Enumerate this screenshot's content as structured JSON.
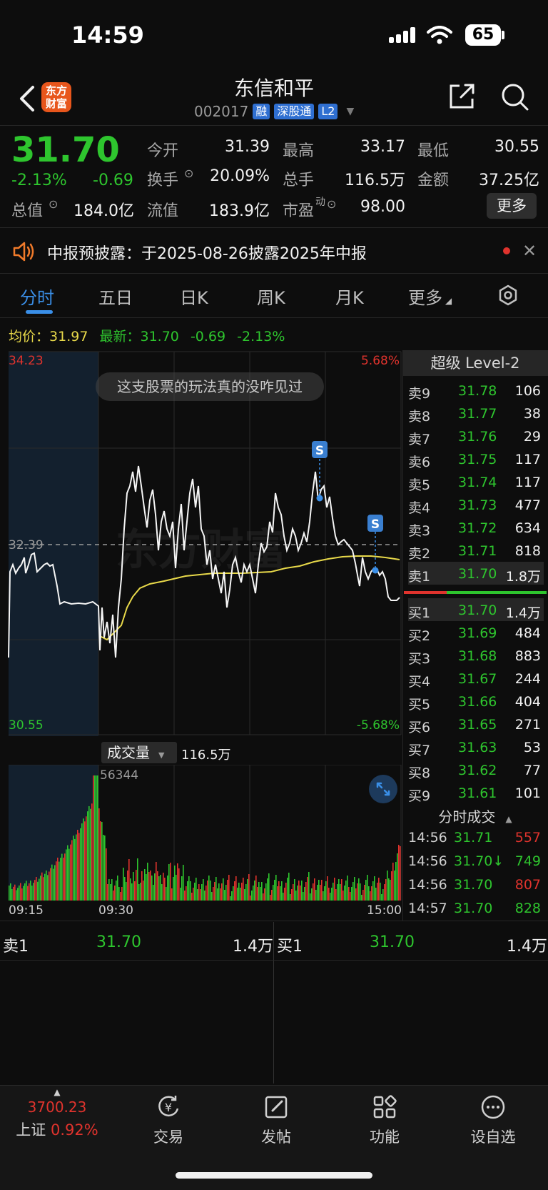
{
  "status_bar": {
    "time": "14:59",
    "battery": "65"
  },
  "header": {
    "logo_line1": "东方",
    "logo_line2": "财富",
    "stock_name": "东信和平",
    "stock_code": "002017",
    "tags": [
      "融",
      "深股通",
      "L2"
    ]
  },
  "quote": {
    "price": "31.70",
    "change_pct": "-2.13%",
    "change": "-0.69",
    "fields": {
      "open_label": "今开",
      "open_value": "31.39",
      "high_label": "最高",
      "high_value": "33.17",
      "low_label": "最低",
      "low_value": "30.55",
      "turnover_label": "换手",
      "turnover_value": "20.09%",
      "volume_label": "总手",
      "volume_value": "116.5万",
      "amount_label": "金额",
      "amount_value": "37.25亿",
      "mktcap_label": "总值",
      "mktcap_value": "184.0亿",
      "float_label": "流值",
      "float_value": "183.9亿",
      "pe_label": "市盈",
      "pe_sup": "动",
      "pe_value": "98.00"
    },
    "more_label": "更多"
  },
  "notice": {
    "text": "中报预披露：于2025-08-26披露2025年中报"
  },
  "tabs": [
    "分时",
    "五日",
    "日K",
    "周K",
    "月K",
    "更多"
  ],
  "intraday": {
    "avg_label": "均价：",
    "avg_value": "31.97",
    "latest_label": "最新：",
    "latest_value": "31.70",
    "latest_change": "-0.69",
    "latest_pct": "-2.13%",
    "y_top": "34.23",
    "y_bottom": "30.55",
    "y_mid": "32.39",
    "pct_top": "5.68%",
    "pct_bottom": "-5.68%",
    "bubble": "这支股票的玩法真的没咋见过",
    "marker": "S",
    "watermark": "东方财富",
    "volume_label": "成交量",
    "volume_total": "116.5万",
    "volume_max": "56344",
    "time_start": "09:15",
    "time_open": "09:30",
    "time_end": "15:00"
  },
  "level2": {
    "title": "超级 Level-2",
    "asks": [
      {
        "label": "卖9",
        "price": "31.78",
        "vol": "106"
      },
      {
        "label": "卖8",
        "price": "31.77",
        "vol": "38"
      },
      {
        "label": "卖7",
        "price": "31.76",
        "vol": "29"
      },
      {
        "label": "卖6",
        "price": "31.75",
        "vol": "117"
      },
      {
        "label": "卖5",
        "price": "31.74",
        "vol": "117"
      },
      {
        "label": "卖4",
        "price": "31.73",
        "vol": "477"
      },
      {
        "label": "卖3",
        "price": "31.72",
        "vol": "634"
      },
      {
        "label": "卖2",
        "price": "31.71",
        "vol": "818"
      },
      {
        "label": "卖1",
        "price": "31.70",
        "vol": "1.8万"
      }
    ],
    "bids": [
      {
        "label": "买1",
        "price": "31.70",
        "vol": "1.4万"
      },
      {
        "label": "买2",
        "price": "31.69",
        "vol": "484"
      },
      {
        "label": "买3",
        "price": "31.68",
        "vol": "883"
      },
      {
        "label": "买4",
        "price": "31.67",
        "vol": "244"
      },
      {
        "label": "买5",
        "price": "31.66",
        "vol": "404"
      },
      {
        "label": "买6",
        "price": "31.65",
        "vol": "271"
      },
      {
        "label": "买7",
        "price": "31.63",
        "vol": "53"
      },
      {
        "label": "买8",
        "price": "31.62",
        "vol": "77"
      },
      {
        "label": "买9",
        "price": "31.61",
        "vol": "101"
      }
    ],
    "ticks_title": "分时成交",
    "ticks": [
      {
        "time": "14:56",
        "price": "31.71",
        "vol": "557",
        "color": "#e0332d"
      },
      {
        "time": "14:56",
        "price": "31.70↓",
        "vol": "749",
        "color": "#2ec52e"
      },
      {
        "time": "14:56",
        "price": "31.70",
        "vol": "807",
        "color": "#e0332d"
      },
      {
        "time": "14:57",
        "price": "31.70",
        "vol": "828",
        "color": "#2ec52e"
      }
    ]
  },
  "bottom_book": {
    "sell_label": "卖1",
    "sell_price": "31.70",
    "sell_vol": "1.4万",
    "buy_label": "买1",
    "buy_price": "31.70",
    "buy_vol": "1.4万"
  },
  "bottom_nav": {
    "index_value": "3700.23",
    "index_name": "上证",
    "index_pct": "0.92%",
    "items": [
      "交易",
      "发帖",
      "功能",
      "设自选"
    ]
  },
  "colors": {
    "up": "#e0332d",
    "down": "#2ec52e",
    "accent": "#3a8fe8",
    "avg_line": "#e8d94a"
  }
}
